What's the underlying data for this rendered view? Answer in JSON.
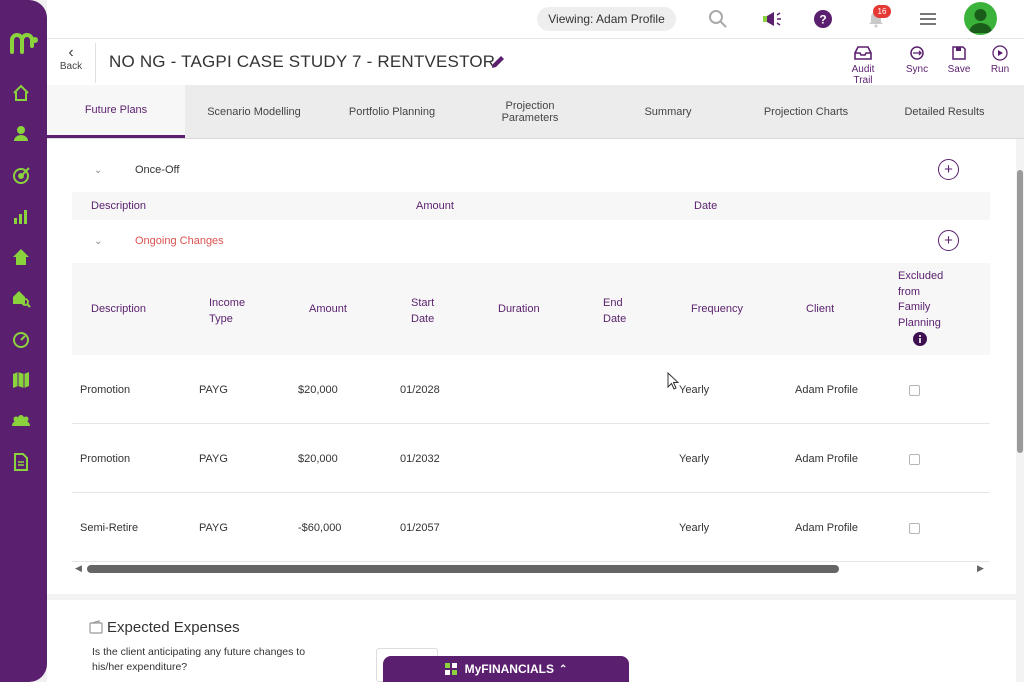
{
  "topbar": {
    "viewing": "Viewing: Adam Profile",
    "notification_count": "16"
  },
  "titlebar": {
    "back_label": "Back",
    "title": "NO NG - TAGPI CASE STUDY 7 - RENTVESTOR",
    "actions": [
      {
        "label": "Audit Trail",
        "icon": "inbox-icon"
      },
      {
        "label": "Sync",
        "icon": "sync-icon"
      },
      {
        "label": "Save",
        "icon": "save-icon"
      },
      {
        "label": "Run",
        "icon": "play-icon"
      }
    ]
  },
  "tabs": [
    {
      "label": "Future Plans",
      "active": true
    },
    {
      "label": "Scenario Modelling",
      "active": false
    },
    {
      "label": "Portfolio Planning",
      "active": false
    },
    {
      "label": "Projection Parameters",
      "active": false
    },
    {
      "label": "Summary",
      "active": false
    },
    {
      "label": "Projection Charts",
      "active": false
    },
    {
      "label": "Detailed Results",
      "active": false
    }
  ],
  "once_off": {
    "title": "Once-Off",
    "columns": [
      "Description",
      "Amount",
      "Date"
    ]
  },
  "ongoing": {
    "title": "Ongoing Changes",
    "columns": {
      "description": "Description",
      "income_type": "Income Type",
      "amount": "Amount",
      "start_date": "Start Date",
      "duration": "Duration",
      "end_date": "End Date",
      "frequency": "Frequency",
      "client": "Client",
      "excluded": "Excluded from Family Planning"
    },
    "rows": [
      {
        "description": "Promotion",
        "income_type": "PAYG",
        "amount": "$20,000",
        "start_date": "01/2028",
        "duration": "",
        "end_date": "",
        "frequency": "Yearly",
        "client": "Adam Profile",
        "excluded": false
      },
      {
        "description": "Promotion",
        "income_type": "PAYG",
        "amount": "$20,000",
        "start_date": "01/2032",
        "duration": "",
        "end_date": "",
        "frequency": "Yearly",
        "client": "Adam Profile",
        "excluded": false
      },
      {
        "description": "Semi-Retire",
        "income_type": "PAYG",
        "amount": "-$60,000",
        "start_date": "01/2057",
        "duration": "",
        "end_date": "",
        "frequency": "Yearly",
        "client": "Adam Profile",
        "excluded": false
      }
    ]
  },
  "expenses": {
    "title": "Expected Expenses",
    "question": "Is the client anticipating any future changes to his/her expenditure?"
  },
  "bottom_bar": {
    "label": "MyFINANCIALS"
  },
  "colors": {
    "brand": "#5a1f6e",
    "ongoing_title": "#d9534f",
    "avatar": "#3bb33b"
  }
}
